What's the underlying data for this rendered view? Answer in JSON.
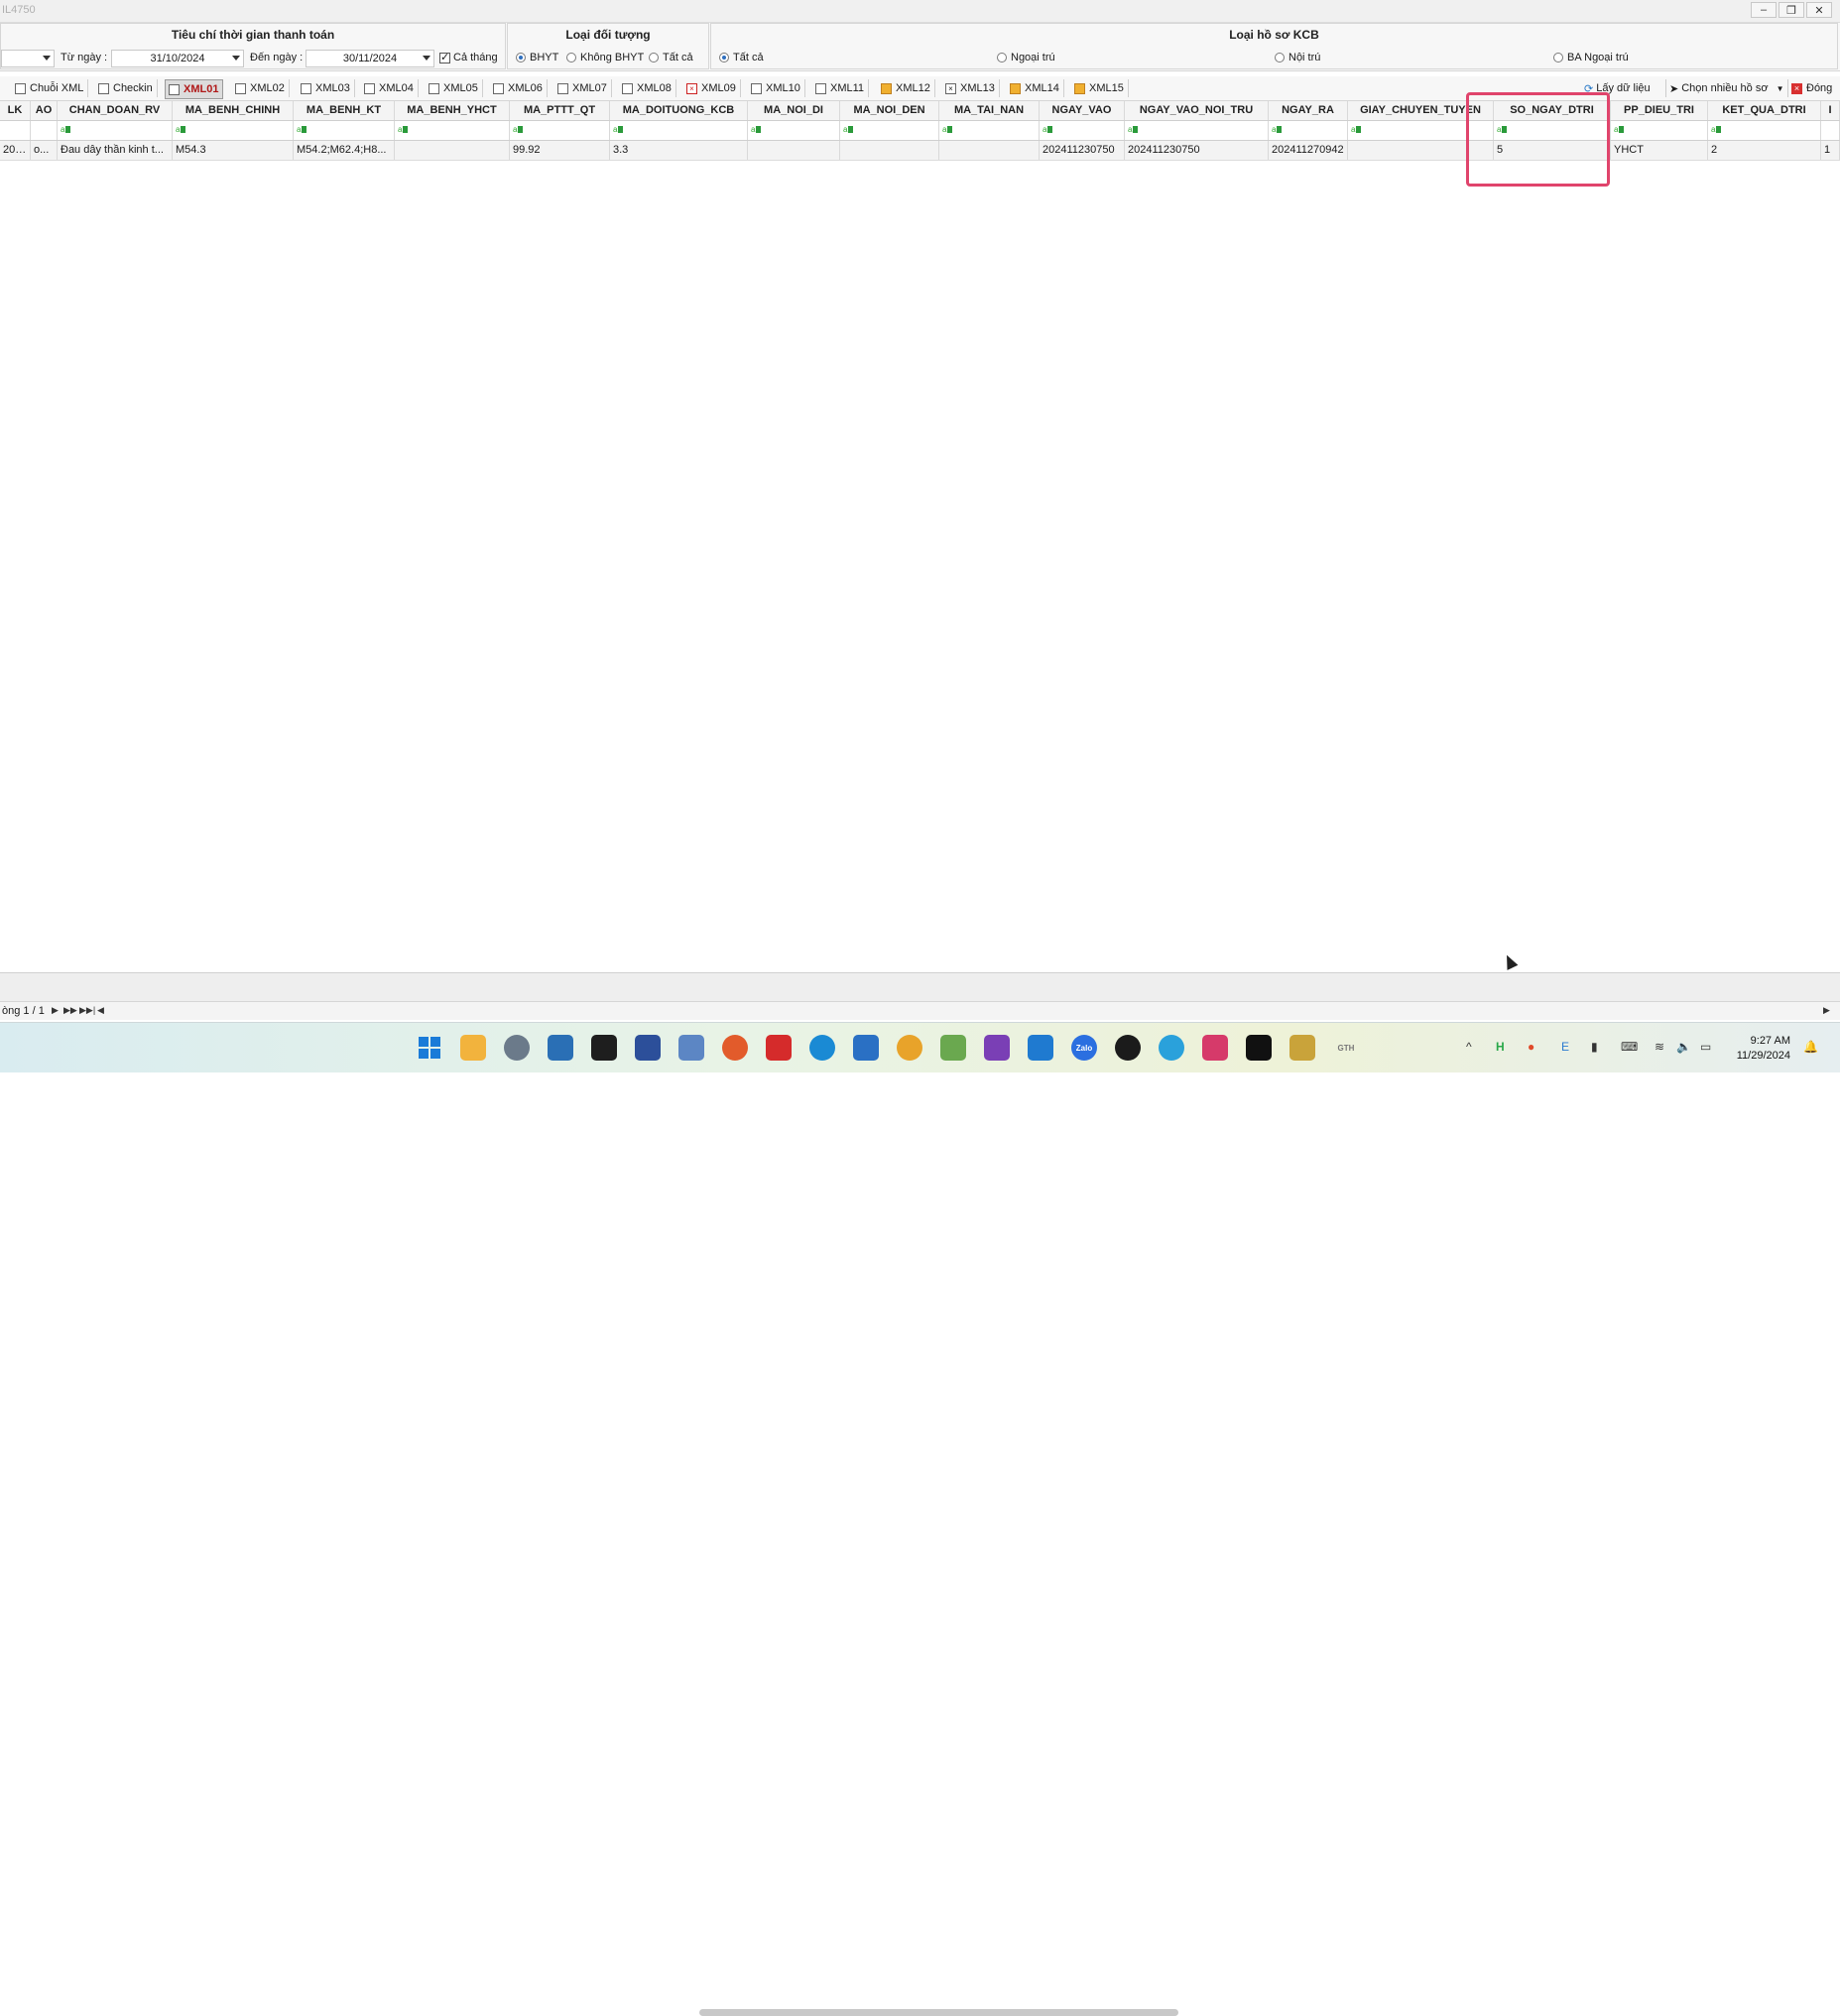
{
  "window": {
    "title": "IL4750"
  },
  "filters": {
    "time_group_title": "Tiêu chí thời gian thanh toán",
    "from_label": "Từ ngày :",
    "from_value": "31/10/2024",
    "to_label": "Đến ngày :",
    "to_value": "30/11/2024",
    "whole_month_label": "Cả tháng",
    "object_group_title": "Loại đối tượng",
    "object_options": [
      "BHYT",
      "Không BHYT",
      "Tất cả"
    ],
    "record_group_title": "Loại hồ sơ KCB",
    "record_options": [
      "Tất cả",
      "Ngoại trú",
      "Nội trú",
      "BA Ngoại trú"
    ]
  },
  "tabs": [
    "Chuỗi XML",
    "Checkin",
    "XML01",
    "XML02",
    "XML03",
    "XML04",
    "XML05",
    "XML06",
    "XML07",
    "XML08",
    "XML09",
    "XML10",
    "XML11",
    "XML12",
    "XML13",
    "XML14",
    "XML15"
  ],
  "toolbar": {
    "get_data": "Lấy dữ liệu",
    "select_many": "Chọn nhiều hồ sơ",
    "close": "Đóng"
  },
  "grid": {
    "columns": [
      "LK",
      "AO",
      "CHAN_DOAN_RV",
      "MA_BENH_CHINH",
      "MA_BENH_KT",
      "MA_BENH_YHCT",
      "MA_PTTT_QT",
      "MA_DOITUONG_KCB",
      "MA_NOI_DI",
      "MA_NOI_DEN",
      "MA_TAI_NAN",
      "NGAY_VAO",
      "NGAY_VAO_NOI_TRU",
      "NGAY_RA",
      "GIAY_CHUYEN_TUYEN",
      "SO_NGAY_DTRI",
      "PP_DIEU_TRI",
      "KET_QUA_DTRI",
      "I"
    ],
    "rows": [
      [
        "202...",
        "o...",
        "Đau dây thần kinh t...",
        "M54.3",
        "M54.2;M62.4;H8...",
        "",
        "99.92",
        "3.3",
        "",
        "",
        "",
        "202411230750",
        "202411230750",
        "202411270942",
        "",
        "5",
        "YHCT",
        "2",
        "1"
      ]
    ]
  },
  "pager": {
    "text": "òng 1 / 1"
  },
  "taskbar": {
    "apps": [
      "start",
      "explorer",
      "settings",
      "search",
      "terminal",
      "powershell",
      "photos",
      "app-orange",
      "app-s",
      "edge",
      "app-blue",
      "app-chrome-like",
      "notepad",
      "visual-studio",
      "vscode",
      "zalo",
      "chatgpt",
      "telegram",
      "app-star",
      "rider",
      "app-bag",
      "app-text"
    ],
    "zalo_label": "Zalo",
    "app_text_label": "GTH",
    "clock_time": "9:27 AM",
    "clock_date": "11/29/2024"
  },
  "colors": {
    "highlight": "#e0446c",
    "active_tab_text": "#b01818",
    "filter_icon": "#2a9a3a"
  }
}
